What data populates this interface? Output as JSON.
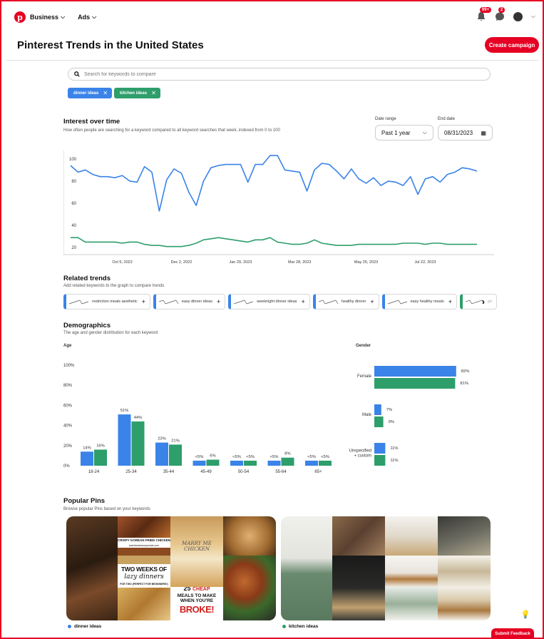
{
  "nav": {
    "business_label": "Business",
    "ads_label": "Ads",
    "notifications_badge": "99+",
    "messages_badge": "2"
  },
  "header": {
    "title": "Pinterest Trends in the United States",
    "create_campaign_label": "Create campaign"
  },
  "search": {
    "placeholder": "Search for keywords to compare"
  },
  "keywords": [
    {
      "label": "dinner ideas",
      "color": "#3a83e8"
    },
    {
      "label": "kitchen ideas",
      "color": "#2e9e6b"
    }
  ],
  "interest": {
    "title": "Interest over time",
    "subtitle": "How often people are searching for a keyword compared to all keyword searches that week, indexed from 0 to 100",
    "date_range_label": "Date range",
    "date_range_value": "Past 1 year",
    "end_date_label": "End date",
    "end_date_value": "08/31/2023"
  },
  "chart_data": [
    {
      "type": "line",
      "ylim": [
        15,
        105
      ],
      "y_ticks": [
        20,
        40,
        60,
        80,
        100
      ],
      "x_tick_labels": [
        "Oct 5, 2022",
        "Dec 2, 2022",
        "Jan 29, 2023",
        "Mar 28, 2023",
        "May 25, 2023",
        "Jul 22, 2023"
      ],
      "x_tick_indices": [
        7,
        15,
        23,
        31,
        40,
        48
      ],
      "series": [
        {
          "name": "dinner ideas",
          "color": "#3a83e8",
          "values": [
            94,
            88,
            90,
            86,
            84,
            84,
            83,
            85,
            80,
            79,
            93,
            88,
            53,
            81,
            91,
            87,
            70,
            58,
            80,
            92,
            94,
            95,
            95,
            95,
            79,
            95,
            95,
            103,
            103,
            90,
            89,
            88,
            71,
            90,
            96,
            95,
            89,
            82,
            91,
            82,
            78,
            83,
            76,
            80,
            79,
            76,
            84,
            68,
            82,
            84,
            79,
            86,
            88,
            92,
            91,
            89
          ]
        },
        {
          "name": "kitchen ideas",
          "color": "#2e9e6b",
          "values": [
            29,
            29,
            25,
            25,
            25,
            25,
            25,
            24,
            25,
            25,
            23,
            22,
            22,
            21,
            21,
            21,
            22,
            24,
            27,
            28,
            29,
            28,
            27,
            26,
            25,
            27,
            27,
            29,
            25,
            24,
            23,
            23,
            24,
            27,
            24,
            23,
            22,
            22,
            22,
            23,
            23,
            23,
            23,
            23,
            23,
            24,
            24,
            24,
            23,
            24,
            24,
            23,
            23,
            23,
            23,
            23
          ]
        }
      ]
    },
    {
      "type": "bar",
      "title": "Age",
      "categories": [
        "18-24",
        "25-34",
        "35-44",
        "45-49",
        "50-54",
        "55-64",
        "65+"
      ],
      "y_ticks": [
        "0%",
        "20%",
        "40%",
        "60%",
        "80%",
        "100%"
      ],
      "ylim": [
        0,
        100
      ],
      "series": [
        {
          "name": "dinner ideas",
          "color": "#3a83e8",
          "values": [
            14,
            51,
            23,
            5,
            5,
            5,
            5
          ],
          "labels": [
            "14%",
            "51%",
            "23%",
            "<5%",
            "<5%",
            "<5%",
            "<5%"
          ]
        },
        {
          "name": "kitchen ideas",
          "color": "#2e9e6b",
          "values": [
            16,
            44,
            21,
            6,
            5,
            8,
            5
          ],
          "labels": [
            "16%",
            "44%",
            "21%",
            "6%",
            "<5%",
            "8%",
            "<5%"
          ]
        }
      ]
    },
    {
      "type": "bar",
      "title": "Gender",
      "categories": [
        "Female",
        "Male",
        "Unspecified\n+ custom"
      ],
      "series": [
        {
          "name": "dinner ideas",
          "color": "#3a83e8",
          "values": [
            82,
            7,
            11
          ],
          "labels": [
            "82%",
            "7%",
            "11%"
          ]
        },
        {
          "name": "kitchen ideas",
          "color": "#2e9e6b",
          "values": [
            81,
            9,
            11
          ],
          "labels": [
            "81%",
            "9%",
            "11%"
          ]
        }
      ]
    }
  ],
  "related": {
    "title": "Related trends",
    "subtitle": "Add related keywords to the graph to compare trends",
    "items": [
      {
        "label": "restriction meals aesthetic"
      },
      {
        "label": "easy dinner ideas"
      },
      {
        "label": "weeknight dinner ideas"
      },
      {
        "label": "healthy dinner"
      },
      {
        "label": "easy healthy meals"
      },
      {
        "label": "gri"
      }
    ]
  },
  "demographics": {
    "title": "Demographics",
    "subtitle": "The age and gender distribution for each keyword"
  },
  "popular": {
    "title": "Popular Pins",
    "subtitle": "Browse popular Pins based on your keywords",
    "pin_texts": {
      "korean_chicken": "CRISPY KOREAN FRIED CHICKEN",
      "korean_site": "sweetandsavorymeals.com",
      "marry_me": "MARRY ME CHICKEN",
      "two_weeks": "TWO WEEKS OF",
      "lazy_dinners": "lazy dinners",
      "for_two": "FOR TWO (PERFECT FOR BEGINNERS!)",
      "cheap_num": "25",
      "cheap_word": "CHEAP",
      "meals_to_make": "MEALS TO MAKE",
      "when_youre": "WHEN YOU'RE",
      "broke": "BROKE!"
    },
    "captions": [
      "dinner ideas",
      "kitchen ideas"
    ]
  },
  "feedback_label": "Submit Feedback"
}
